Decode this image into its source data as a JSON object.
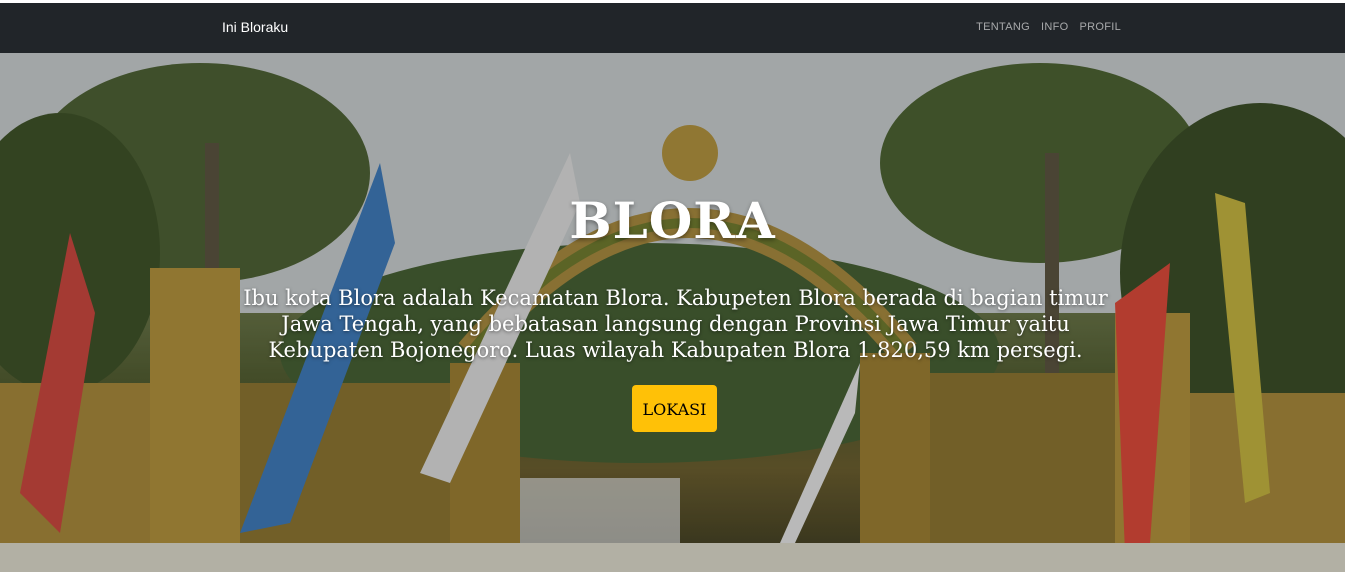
{
  "navbar": {
    "brand": "Ini Bloraku",
    "links": [
      "TENTANG",
      "INFO",
      "PROFIL"
    ],
    "background": "#212529"
  },
  "hero": {
    "title": "BLORA",
    "description": "Ibu kota Blora adalah Kecamatan Blora. Kabupeten Blora berada di bagian timur Jawa Tengah, yang bebatasan langsung dengan Provinsi Jawa Timur yaitu Kebupaten Bojonegoro. Luas wilayah Kabupaten Blora 1.820,59 km persegi.",
    "button_label": "LOKASI",
    "button_color": "#ffc107"
  }
}
